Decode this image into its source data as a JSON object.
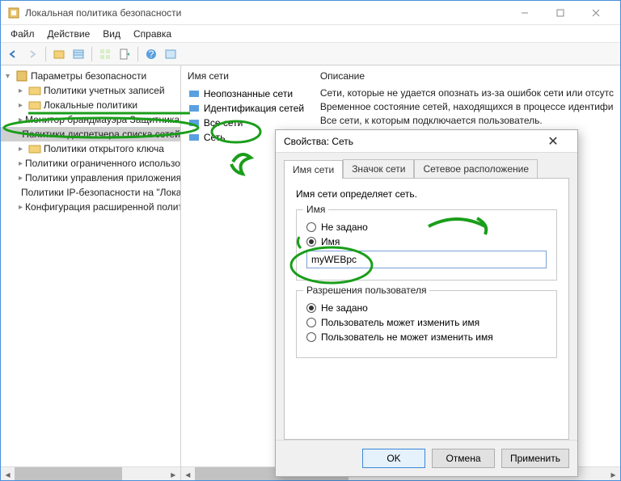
{
  "window": {
    "title": "Локальная политика безопасности"
  },
  "menu": {
    "file": "Файл",
    "action": "Действие",
    "view": "Вид",
    "help": "Справка"
  },
  "tree": {
    "root": "Параметры безопасности",
    "items": [
      "Политики учетных записей",
      "Локальные политики",
      "Монитор брандмауэра Защитника Wind",
      "Политики диспетчера списка сетей",
      "Политики открытого ключа",
      "Политики ограниченного использовани",
      "Политики управления приложениями",
      "Политики IP-безопасности на \"Локальн",
      "Конфигурация расширенной политики а"
    ]
  },
  "right": {
    "col1": "Имя сети",
    "col2": "Описание",
    "nets": [
      "Неопознанные сети",
      "Идентификация сетей",
      "Все сети",
      "Сеть"
    ],
    "desc1": "Сети, которые не удается опознать из-за ошибок сети или отсутс",
    "desc2": "Временное состояние сетей, находящихся в процессе идентифи",
    "desc3": "Все сети, к которым подключается пользователь."
  },
  "dialog": {
    "title": "Свойства: Сеть",
    "tabs": {
      "t1": "Имя сети",
      "t2": "Значок сети",
      "t3": "Сетевое расположение"
    },
    "hint": "Имя сети определяет сеть.",
    "group_name": {
      "legend": "Имя",
      "opt1": "Не задано",
      "opt2": "Имя",
      "value": "myWEBpc"
    },
    "group_perm": {
      "legend": "Разрешения пользователя",
      "opt1": "Не задано",
      "opt2": "Пользователь может изменить имя",
      "opt3": "Пользователь не может изменить имя"
    },
    "buttons": {
      "ok": "OK",
      "cancel": "Отмена",
      "apply": "Применить"
    }
  },
  "annotations": {
    "num2": "2",
    "num3_shape": "arrow"
  }
}
